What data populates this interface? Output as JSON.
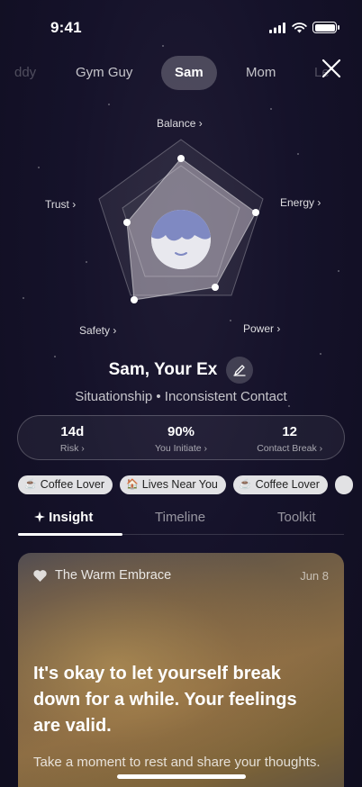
{
  "status": {
    "time": "9:41"
  },
  "profiles": [
    {
      "label": "ddy"
    },
    {
      "label": "Gym Guy"
    },
    {
      "label": "Sam"
    },
    {
      "label": "Mom"
    },
    {
      "label": "Le"
    }
  ],
  "radar": {
    "labels": {
      "balance": "Balance",
      "energy": "Energy",
      "power": "Power",
      "safety": "Safety",
      "trust": "Trust"
    },
    "chevron": "›"
  },
  "person": {
    "name": "Sam, Your Ex",
    "subtitle": "Situationship • Inconsistent Contact"
  },
  "stats": [
    {
      "value": "14d",
      "label": "Risk"
    },
    {
      "value": "90%",
      "label": "You Initiate"
    },
    {
      "value": "12",
      "label": "Contact Break"
    }
  ],
  "tags": [
    {
      "icon": "coffee-icon",
      "glyph": "☕",
      "label": "Coffee Lover"
    },
    {
      "icon": "house-icon",
      "glyph": "🏠",
      "label": "Lives Near You"
    },
    {
      "icon": "coffee-icon",
      "glyph": "☕",
      "label": "Coffee Lover"
    }
  ],
  "section_tabs": [
    {
      "label": "Insight",
      "icon": "sparkle-icon"
    },
    {
      "label": "Timeline"
    },
    {
      "label": "Toolkit"
    }
  ],
  "card": {
    "icon": "heart-icon",
    "title": "The Warm Embrace",
    "date": "Jun 8",
    "quote": "It's okay to let yourself break down for a while. Your feelings are valid.",
    "subtext": "Take a moment to rest and share your thoughts."
  },
  "colors": {
    "background": "#15122a",
    "accent": "#ffffff"
  }
}
